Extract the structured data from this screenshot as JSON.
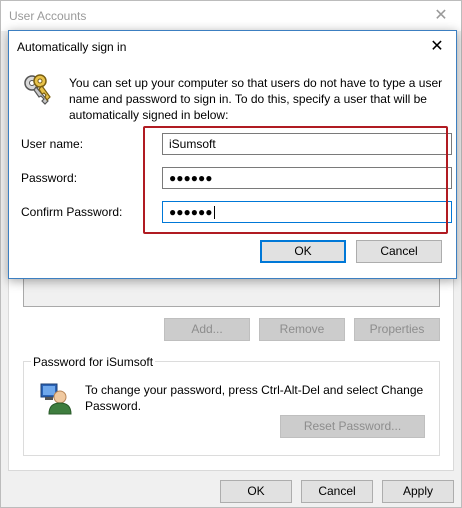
{
  "background_window": {
    "title": "User Accounts",
    "buttons": {
      "add": "Add...",
      "remove": "Remove",
      "properties": "Properties"
    },
    "password_group": {
      "title": "Password for iSumsoft",
      "text": "To change your password, press Ctrl-Alt-Del and select Change Password.",
      "reset_button": "Reset Password..."
    },
    "footer": {
      "ok": "OK",
      "cancel": "Cancel",
      "apply": "Apply"
    }
  },
  "dialog": {
    "title": "Automatically sign in",
    "description": "You can set up your computer so that users do not have to type a user name and password to sign in. To do this, specify a user that will be automatically signed in below:",
    "fields": {
      "user_name_label": "User name:",
      "user_name_value": "iSumsoft",
      "password_label": "Password:",
      "password_value": "●●●●●●",
      "confirm_label": "Confirm Password:",
      "confirm_value": "●●●●●●"
    },
    "buttons": {
      "ok": "OK",
      "cancel": "Cancel"
    }
  },
  "icons": {
    "keys": "keys-icon",
    "user": "user-icon",
    "close": "close-icon"
  },
  "colors": {
    "highlight_border": "#b01b22",
    "accent": "#0078d7"
  }
}
